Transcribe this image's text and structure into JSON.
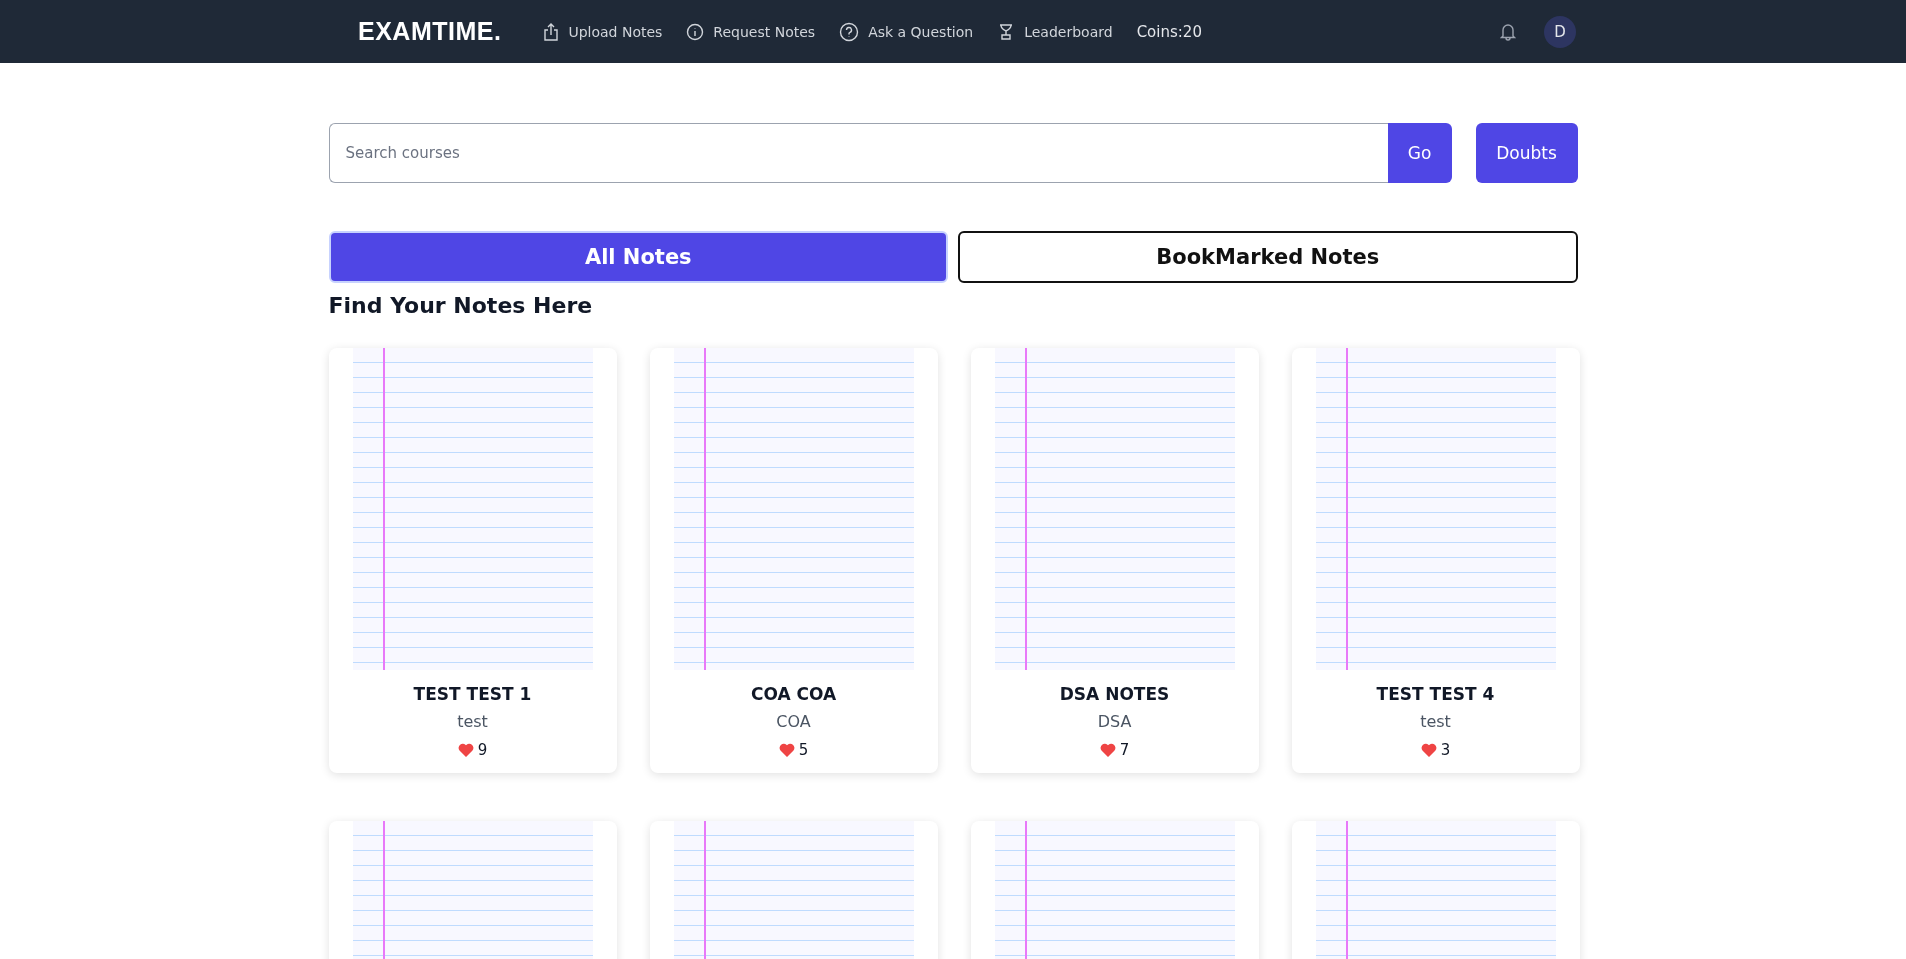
{
  "navbar": {
    "logo": "EXAMTIME.",
    "links": [
      {
        "label": "Upload Notes",
        "kind": "upload"
      },
      {
        "label": "Request Notes",
        "kind": "info"
      },
      {
        "label": "Ask a Question",
        "kind": "question"
      },
      {
        "label": "Leaderboard",
        "kind": "trophy"
      }
    ],
    "coins": "Coins:20",
    "avatar": "D"
  },
  "search": {
    "placeholder": "Search courses",
    "go": "Go",
    "doubts": "Doubts"
  },
  "tabs": [
    {
      "label": "All Notes",
      "selected": true
    },
    {
      "label": "BookMarked Notes",
      "selected": false
    }
  ],
  "heading": "Find Your Notes Here",
  "notes": [
    {
      "kind": "full",
      "title": "TEST TEST 1",
      "subject": "test",
      "likes": "9"
    },
    {
      "kind": "full",
      "title": "COA COA",
      "subject": "COA",
      "likes": "5"
    },
    {
      "kind": "full",
      "title": "DSA NOTES",
      "subject": "DSA",
      "likes": "7"
    },
    {
      "kind": "full",
      "title": "TEST TEST 4",
      "subject": "test",
      "likes": "3"
    },
    {
      "kind": "image-only"
    },
    {
      "kind": "image-only"
    },
    {
      "kind": "image-only"
    },
    {
      "kind": "image-only"
    }
  ]
}
